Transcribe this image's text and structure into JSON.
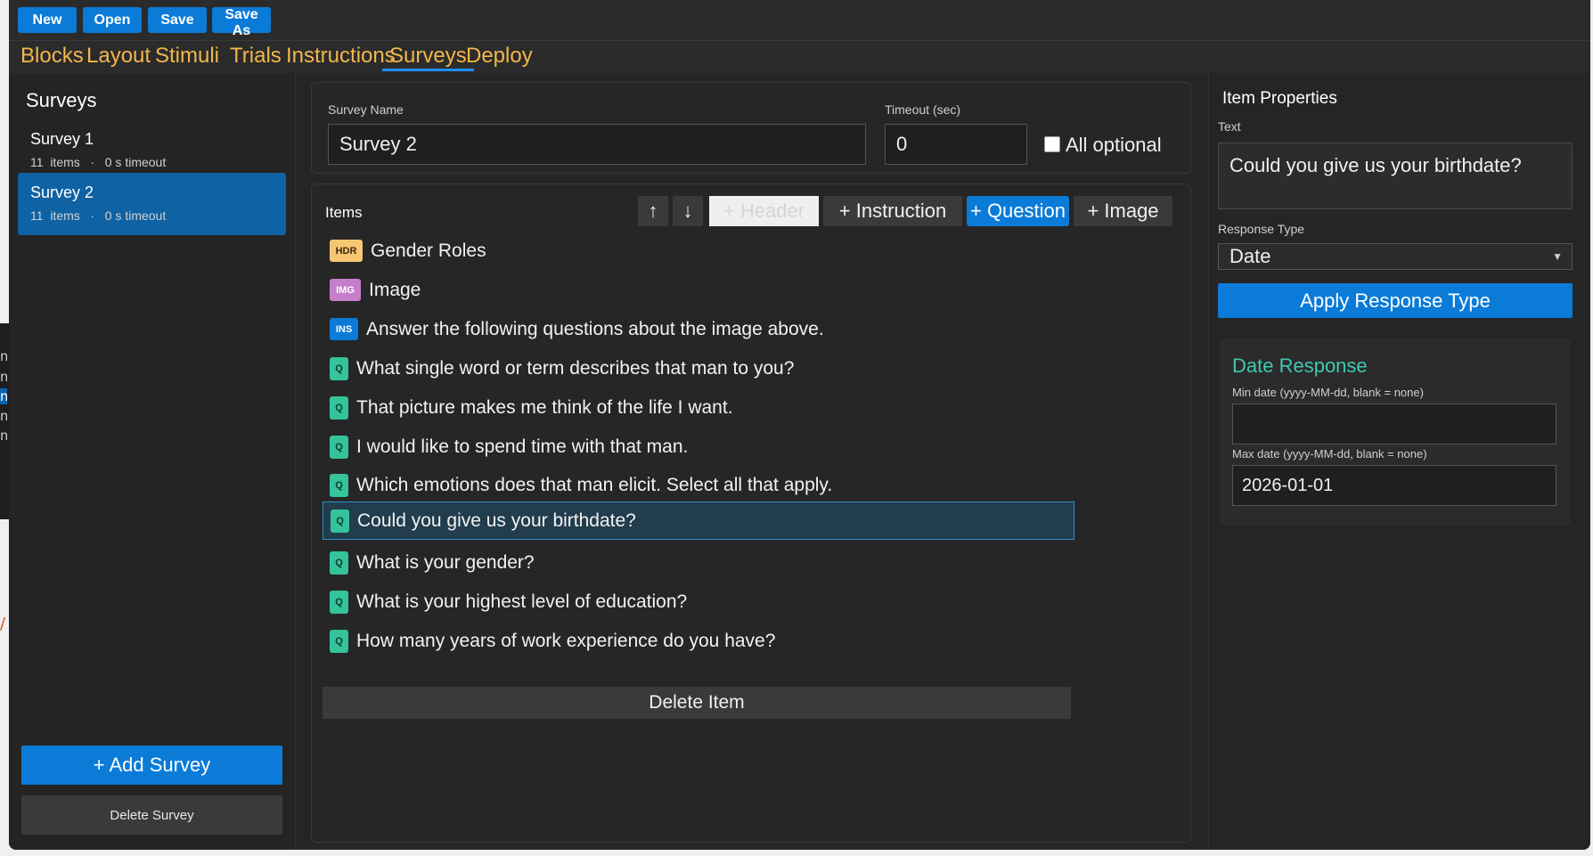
{
  "toolbar": {
    "new": "New",
    "open": "Open",
    "save": "Save",
    "save_as": "Save As"
  },
  "nav": {
    "tabs": [
      "Blocks",
      "Layout",
      "Stimuli",
      "Trials",
      "Instructions",
      "Surveys",
      "Deploy"
    ],
    "active": "Surveys"
  },
  "sidebar": {
    "title": "Surveys",
    "surveys": [
      {
        "name": "Survey 1",
        "meta": "11  items   ·   0 s timeout"
      },
      {
        "name": "Survey 2",
        "meta": "11  items   ·   0 s timeout"
      }
    ],
    "add_label": "+ Add Survey",
    "delete_label": "Delete Survey"
  },
  "survey_form": {
    "name_label": "Survey Name",
    "name_value": "Survey 2",
    "timeout_label": "Timeout (sec)",
    "timeout_value": "0",
    "all_optional_label": "All optional"
  },
  "items_panel": {
    "title": "Items",
    "up": "↑",
    "down": "↓",
    "add_header": "+ Header",
    "add_instruction": "+ Instruction",
    "add_question": "+ Question",
    "add_image": "+ Image",
    "delete_item": "Delete Item",
    "items": [
      {
        "badge": "HDR",
        "type": "hdr",
        "text": "Gender Roles"
      },
      {
        "badge": "IMG",
        "type": "img",
        "text": "Image"
      },
      {
        "badge": "INS",
        "type": "ins",
        "text": "Answer the following questions about the image above."
      },
      {
        "badge": "Q",
        "type": "q",
        "text": "What single word or term describes that man to you?"
      },
      {
        "badge": "Q",
        "type": "q",
        "text": "That picture makes me think of the life I want."
      },
      {
        "badge": "Q",
        "type": "q",
        "text": "I would like to spend time with that man."
      },
      {
        "badge": "Q",
        "type": "q",
        "text": "Which emotions does that man elicit. Select all that apply."
      },
      {
        "badge": "Q",
        "type": "q",
        "text": "Could you give us your birthdate?"
      },
      {
        "badge": "Q",
        "type": "q",
        "text": "What is your gender?"
      },
      {
        "badge": "Q",
        "type": "q",
        "text": "What is your highest level of education?"
      },
      {
        "badge": "Q",
        "type": "q",
        "text": "How many years of work experience do you have?"
      }
    ]
  },
  "properties": {
    "title": "Item Properties",
    "text_label": "Text",
    "text_value": "Could you give us your birthdate?",
    "response_type_label": "Response Type",
    "response_type_value": "Date",
    "apply_label": "Apply Response Type",
    "date_title": "Date Response",
    "min_label": "Min date (yyyy-MM-dd, blank = none)",
    "min_value": "",
    "max_label": "Max date (yyyy-MM-dd, blank = none)",
    "max_value": "2026-01-01"
  },
  "colors": {
    "accent": "#0b7bd8",
    "tab_text": "#f2b64a",
    "date_title": "#3fc8b0",
    "selection": "#223d4d"
  }
}
